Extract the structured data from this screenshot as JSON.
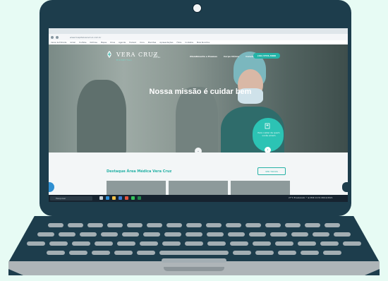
{
  "browser": {
    "url": "www.hospitalveracruz.com.br",
    "bookmarks": [
      "Caixa de Entrada",
      "Gmail",
      "YouTube",
      "Notícias",
      "Mapas",
      "Drive",
      "Agenda",
      "Traduzir",
      "Docs",
      "Planilhas",
      "Apresentações",
      "Fotos",
      "Contatos",
      "Mais favoritos"
    ]
  },
  "site": {
    "logo_text": "VERA CRUZ",
    "logo_sub": "HOSPITAL",
    "unit_label": "Alto\nPadrão",
    "menu": [
      "Atendimento e Exames",
      "Corpo Clínico",
      "Convênios"
    ],
    "phone": "(19) 3734-3000",
    "headline": "Nossa missão é cuidar bem",
    "bubble_text": "Para cuidar de quem vocês amam",
    "section_title": "Destaque Área Médica Vera Cruz",
    "see_all": "VER TODOS"
  },
  "taskbar": {
    "search_placeholder": "Pesquisar",
    "tray": "27°C Ensolarado  ^  ⊞  POR  14:31  08/12/2021"
  },
  "colors": {
    "laptop_body": "#1d3d4c",
    "accent": "#27b2a6",
    "background": "#e7fbf4",
    "keys": "#a3aeb3"
  }
}
